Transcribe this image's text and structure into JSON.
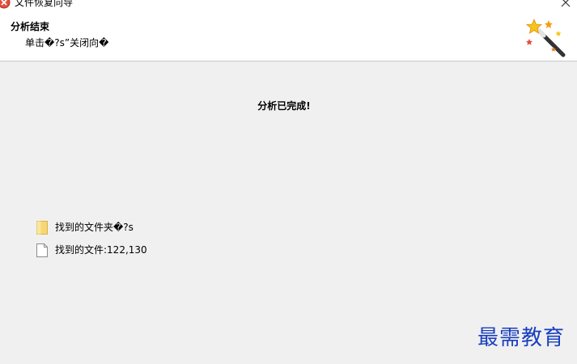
{
  "window": {
    "title": "文件恢复向导",
    "close_glyph": "✕"
  },
  "header": {
    "title": "分析结束",
    "subtitle": "单击�?s”关闭向�"
  },
  "main": {
    "status": "分析已完成!",
    "results": [
      {
        "icon": "folder-icon",
        "label": "找到的文件夹�?s"
      },
      {
        "icon": "file-icon",
        "label": "找到的文件:122,130"
      }
    ]
  },
  "watermark": "最需教育",
  "colors": {
    "background": "#f0f0f0",
    "header_background": "#ffffff",
    "folder_fill": "#f7d774",
    "watermark": "#1a3fbf"
  }
}
